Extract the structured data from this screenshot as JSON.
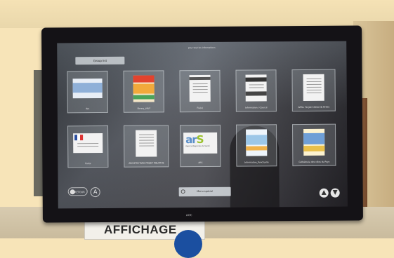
{
  "screen": {
    "title": "pour tout les informations",
    "group_button": "Group list",
    "tiles_row1": [
      {
        "label": "flm"
      },
      {
        "label": "library_info?"
      },
      {
        "label": "Flu(x)"
      },
      {
        "label": "Information / Council"
      },
      {
        "label": "APRIL TO JULY 2016 EN FETES"
      }
    ],
    "tiles_row2": [
      {
        "label": "Pacte"
      },
      {
        "label": "ARCHITECTURE PROJET MEURTHE"
      },
      {
        "label": "ARS"
      },
      {
        "label": "Information_Ponctuelle"
      },
      {
        "label": "Cathédrale des villes du Pays"
      }
    ],
    "ars_logo": {
      "main": "ar",
      "accent": "S",
      "sub": "Agence Régionale de Santé"
    },
    "retour_button": "RETOUR",
    "accessibility_button": "A",
    "search_bar": "Menu spécial",
    "nav_up": "▲",
    "nav_down": "▼",
    "brand": "AOC"
  },
  "sign": {
    "text": "AFFICHAGE"
  },
  "colors": {
    "wall": "#f7e4b8",
    "bezel": "#141216",
    "sign_blue": "#1b4fa0",
    "ars_blue": "#5a8fc9",
    "ars_green": "#9ac12b"
  }
}
